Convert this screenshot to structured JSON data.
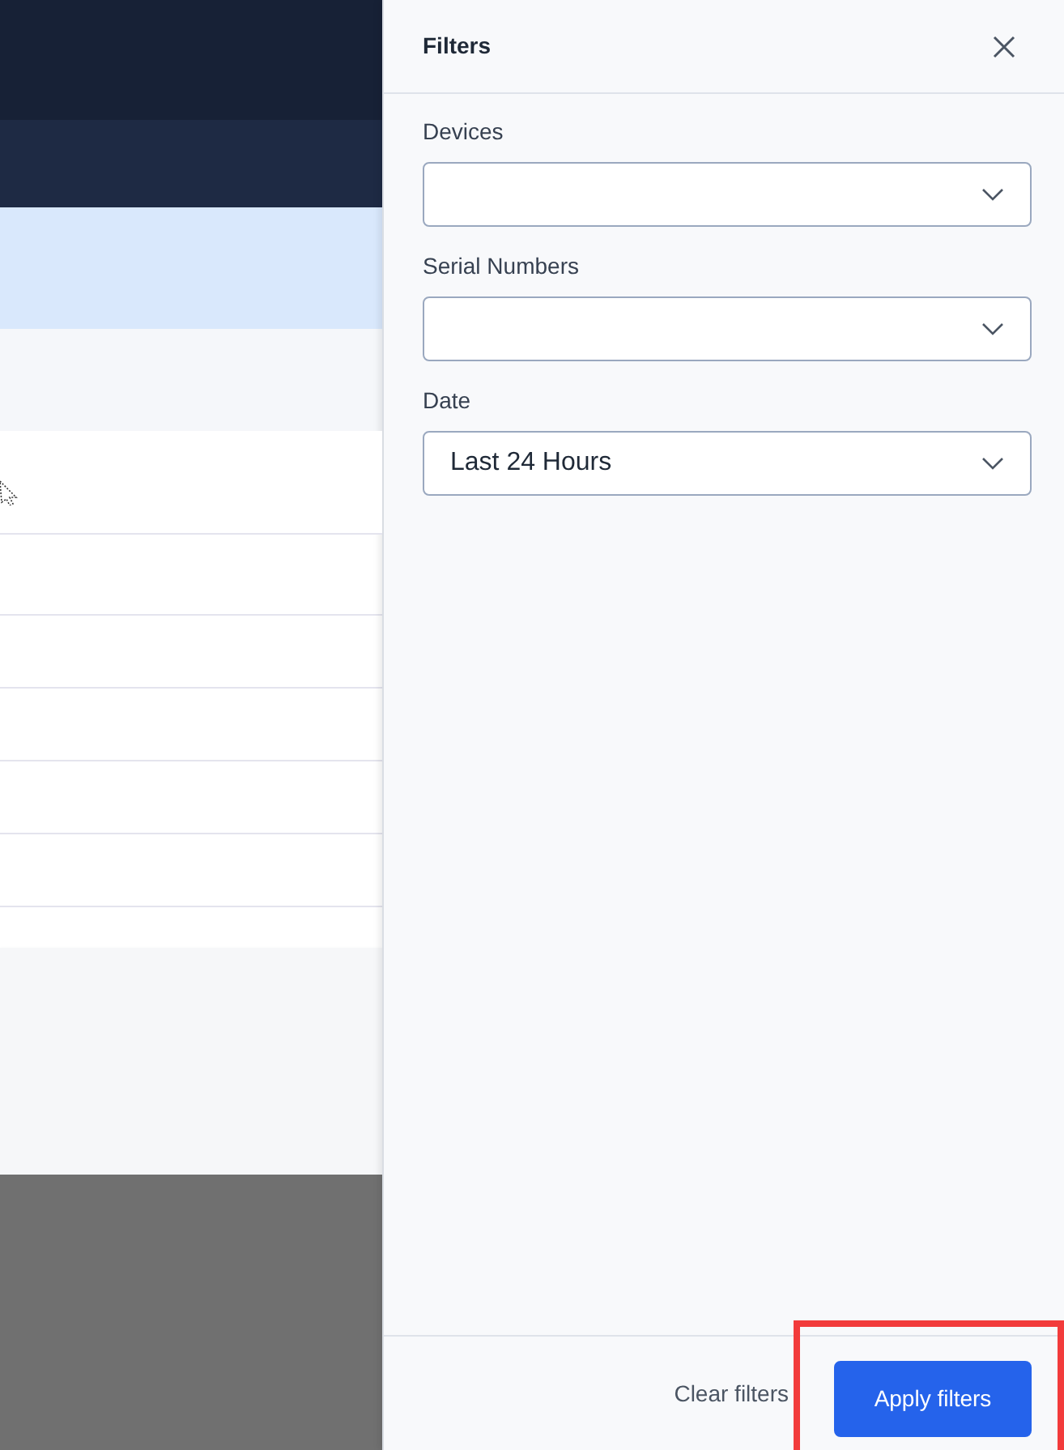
{
  "panel": {
    "title": "Filters"
  },
  "fields": [
    {
      "label": "Devices"
    },
    {
      "label": "Serial Numbers"
    },
    {
      "label": "Date",
      "value": "Last 24 Hours"
    }
  ],
  "footer": {
    "buttons": [
      {
        "label": "Clear filters",
        "kind": "link"
      },
      {
        "label": "Apply filters",
        "kind": "primary",
        "highlighted": true
      }
    ]
  }
}
